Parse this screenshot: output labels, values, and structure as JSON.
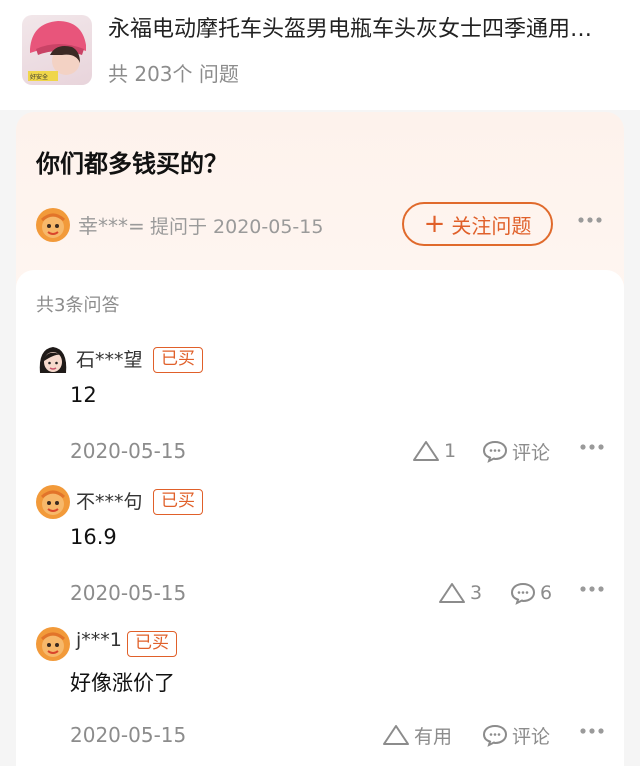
{
  "product": {
    "title": "永福电动摩托车头盔男电瓶车头灰女士四季通用…",
    "question_count": "共 203个 问题"
  },
  "question": {
    "text": "你们都多钱买的？",
    "asker": "幸***=",
    "asked_label": "提问于 2020-05-15",
    "follow_label": "关注问题"
  },
  "answers_header": "共3条问答",
  "answers": [
    {
      "user": "石***望",
      "badge": "已买",
      "content": "12",
      "date": "2020-05-15",
      "like_label": "1",
      "comment_label": "评论",
      "avatar": "girl-avatar"
    },
    {
      "user": "不***句",
      "badge": "已买",
      "content": "16.9",
      "date": "2020-05-15",
      "like_label": "3",
      "comment_label": "6",
      "avatar": "orange-doll-avatar"
    },
    {
      "user": "j***1",
      "badge": "已买",
      "content": "好像涨价了",
      "date": "2020-05-15",
      "like_label": "有用",
      "comment_label": "评论",
      "avatar": "orange-doll-avatar"
    }
  ],
  "colors": {
    "accent": "#e0602a",
    "muted": "#8c8c8c",
    "card_bg": "#fdf2ec"
  }
}
